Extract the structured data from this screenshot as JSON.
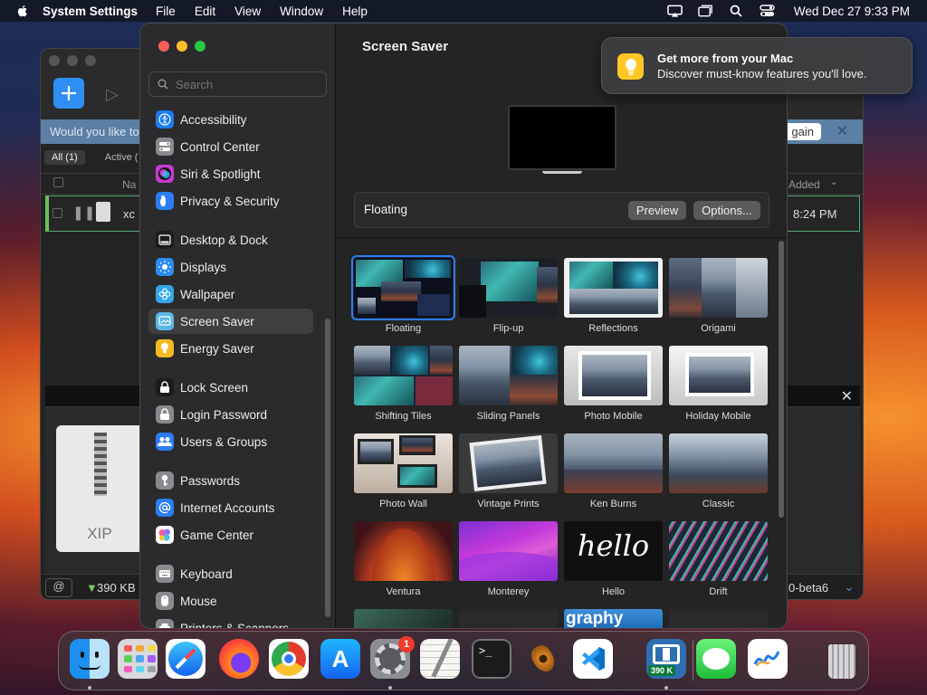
{
  "menubar": {
    "app_name": "System Settings",
    "menus": [
      "File",
      "Edit",
      "View",
      "Window",
      "Help"
    ],
    "clock": "Wed Dec 27  9:33 PM",
    "icons": [
      "screen-mirroring-icon",
      "window-icon",
      "search-icon",
      "control-center-icon"
    ]
  },
  "background_app": {
    "banner_text": "Would you like to",
    "again_button": "gain",
    "tabs": [
      "All (1)",
      "Active ("
    ],
    "name_header": "Na",
    "added_header": "Added",
    "row_name": "xc",
    "row_time": "8:24 PM",
    "file_label": "XIP",
    "status_size": "390 KB",
    "status_version": "0-beta6"
  },
  "settings": {
    "search_placeholder": "Search",
    "sidebar_items": [
      {
        "label": "Accessibility",
        "icon": "accessibility-icon",
        "color": "#1a7cf0"
      },
      {
        "label": "Control Center",
        "icon": "control-center-icon",
        "color": "#8a8a8e"
      },
      {
        "label": "Siri & Spotlight",
        "icon": "siri-icon",
        "color": "#c43bd1"
      },
      {
        "label": "Privacy & Security",
        "icon": "hand-icon",
        "color": "#2a7df4"
      },
      {
        "label": "Desktop & Dock",
        "icon": "dock-icon",
        "color": "#1c1c1e"
      },
      {
        "label": "Displays",
        "icon": "sun-icon",
        "color": "#2a8cf0"
      },
      {
        "label": "Wallpaper",
        "icon": "flower-icon",
        "color": "#33a6e8"
      },
      {
        "label": "Screen Saver",
        "icon": "screensaver-icon",
        "color": "#5ab8e6"
      },
      {
        "label": "Energy Saver",
        "icon": "battery-icon",
        "color": "#f5b924"
      },
      {
        "label": "Lock Screen",
        "icon": "lock-icon",
        "color": "#1c1c1e"
      },
      {
        "label": "Login Password",
        "icon": "padlock-icon",
        "color": "#8a8a8e"
      },
      {
        "label": "Users & Groups",
        "icon": "users-icon",
        "color": "#2a7df4"
      },
      {
        "label": "Passwords",
        "icon": "key-icon",
        "color": "#8a8a8e"
      },
      {
        "label": "Internet Accounts",
        "icon": "at-icon",
        "color": "#2a7df4"
      },
      {
        "label": "Game Center",
        "icon": "game-center-icon",
        "color": "#ffffff"
      },
      {
        "label": "Keyboard",
        "icon": "keyboard-icon",
        "color": "#8a8a8e"
      },
      {
        "label": "Mouse",
        "icon": "mouse-icon",
        "color": "#8a8a8e"
      },
      {
        "label": "Printers & Scanners",
        "icon": "printer-icon",
        "color": "#8a8a8e"
      }
    ],
    "selected_item": "Screen Saver",
    "page_title": "Screen Saver",
    "current_saver": "Floating",
    "preview_button": "Preview",
    "options_button": "Options...",
    "savers": [
      {
        "label": "Floating",
        "selected": true
      },
      {
        "label": "Flip-up"
      },
      {
        "label": "Reflections"
      },
      {
        "label": "Origami"
      },
      {
        "label": "Shifting Tiles"
      },
      {
        "label": "Sliding Panels"
      },
      {
        "label": "Photo Mobile"
      },
      {
        "label": "Holiday Mobile"
      },
      {
        "label": "Photo Wall"
      },
      {
        "label": "Vintage Prints"
      },
      {
        "label": "Ken Burns"
      },
      {
        "label": "Classic"
      },
      {
        "label": "Ventura"
      },
      {
        "label": "Monterey"
      },
      {
        "label": "Hello"
      },
      {
        "label": "Drift"
      }
    ],
    "hello_text": "hello",
    "partial_text": "graphy"
  },
  "notification": {
    "title": "Get more from your Mac",
    "body": "Discover must-know features you'll love."
  },
  "dock": {
    "apps": [
      {
        "name": "Finder",
        "icon": "finder-icon",
        "running": true
      },
      {
        "name": "Launchpad",
        "icon": "launchpad-icon"
      },
      {
        "name": "Safari",
        "icon": "safari-icon"
      },
      {
        "name": "Firefox",
        "icon": "firefox-icon"
      },
      {
        "name": "Chrome",
        "icon": "chrome-icon"
      },
      {
        "name": "App Store",
        "icon": "app-store-icon"
      },
      {
        "name": "System Settings",
        "icon": "system-settings-icon",
        "running": true,
        "badge": "1"
      },
      {
        "name": "TextEdit",
        "icon": "textedit-icon"
      },
      {
        "name": "Terminal",
        "icon": "terminal-icon"
      },
      {
        "name": "GarageBand",
        "icon": "garageband-icon"
      },
      {
        "name": "Visual Studio Code",
        "icon": "vscode-icon"
      },
      {
        "name": "Downloader",
        "icon": "downloader-icon",
        "running": true,
        "label": "390 K"
      },
      {
        "name": "Messages",
        "icon": "messages-icon"
      },
      {
        "name": "Freeform",
        "icon": "freeform-icon"
      },
      {
        "name": "Trash",
        "icon": "trash-icon"
      }
    ]
  }
}
